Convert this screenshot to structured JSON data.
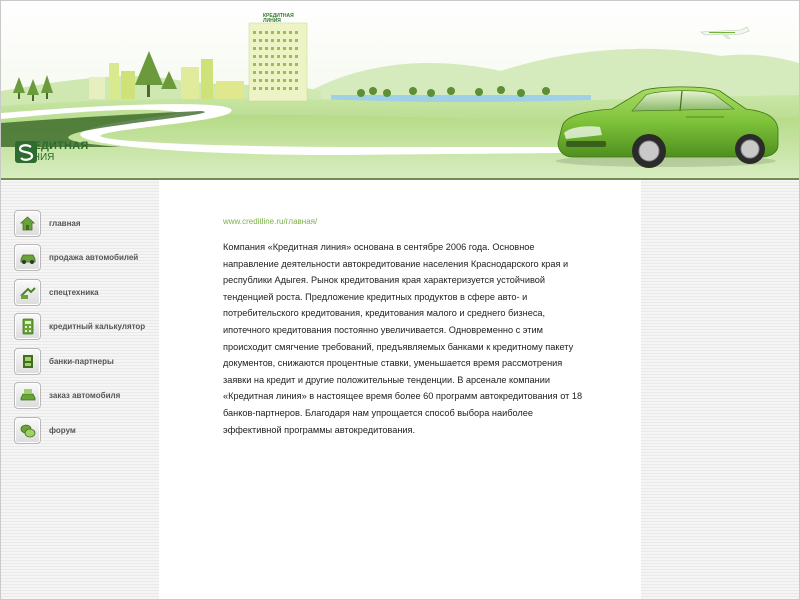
{
  "header": {
    "logo_line1": "КРЕДИТНАЯ",
    "logo_line2": "ЛИНИЯ",
    "tower_sign_line1": "КРЕДИТНАЯ",
    "tower_sign_line2": "ЛИНИЯ"
  },
  "nav": {
    "items": [
      {
        "label": "главная",
        "icon": "home-icon"
      },
      {
        "label": "продажа автомобилей",
        "icon": "car-icon"
      },
      {
        "label": "спецтехника",
        "icon": "machinery-icon"
      },
      {
        "label": "кредитный калькулятор",
        "icon": "calculator-icon"
      },
      {
        "label": "банки-партнеры",
        "icon": "bank-icon"
      },
      {
        "label": "заказ автомобиля",
        "icon": "order-icon"
      },
      {
        "label": "форум",
        "icon": "forum-icon"
      }
    ]
  },
  "content": {
    "breadcrumb": "www.creditline.ru/главная/",
    "text": "Компания «Кредитная линия» основана в сентябре 2006 года. Основное направление деятельности  автокредитование населения Краснодарского края и республики Адыгея. Рынок кредитования края характеризуется устойчивой тенденцией роста. Предложение кредитных продуктов в сфере авто- и потребительского кредитования, кредитования малого и среднего бизнеса, ипотечного кредитования постоянно увеличивается. Одновременно с этим происходит смягчение требований, предъявляемых банками к кредитному пакету документов, снижаются процентные ставки, уменьшается время рассмотрения заявки на кредит и другие положительные тенденции. В арсенале компании «Кредитная линия» в настоящее время более 60 программ автокредитования от 18 банков-партнеров. Благодаря нам упрощается способ выбора наиболее эффективной программы автокредитования."
  },
  "colors": {
    "brand_green": "#2e6b2e",
    "accent_green": "#7bb04a",
    "car_green": "#7ec23a"
  }
}
